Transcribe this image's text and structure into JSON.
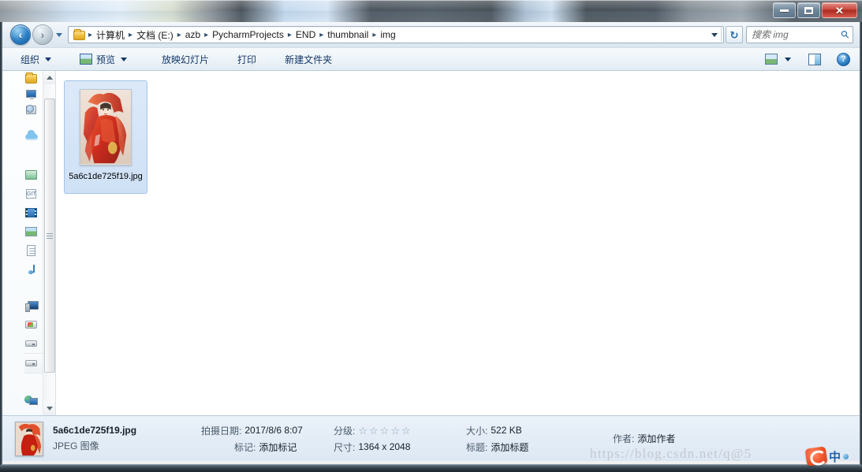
{
  "window": {
    "controls": {
      "minimize_label": "–",
      "maximize_label": "",
      "close_label": "✕"
    }
  },
  "address_bar": {
    "back_glyph": "‹",
    "forward_glyph": "›",
    "history_icon": "chevron-down-icon",
    "folder_icon": "folder-icon",
    "separator": "▸",
    "breadcrumbs": [
      {
        "label": "计算机"
      },
      {
        "label": "文档 (E:)"
      },
      {
        "label": "azb"
      },
      {
        "label": "PycharmProjects"
      },
      {
        "label": "END"
      },
      {
        "label": "thumbnail"
      },
      {
        "label": "img"
      }
    ],
    "refresh_icon": "refresh-icon",
    "search": {
      "placeholder": "搜索 img",
      "value": "",
      "icon": "search-icon"
    }
  },
  "toolbar": {
    "organize_label": "组织",
    "preview_label": "预览",
    "slideshow_label": "放映幻灯片",
    "print_label": "打印",
    "new_folder_label": "新建文件夹",
    "view_icon": "view-mode-icon",
    "panes_icon": "preview-pane-icon",
    "help_icon": "help-icon",
    "help_glyph": "?"
  },
  "nav_pane": {
    "items": [
      {
        "icon": "folder-icon",
        "name": "favorites"
      },
      {
        "icon": "desktop-icon",
        "name": "desktop"
      },
      {
        "icon": "recent-places-icon",
        "name": "recent-places"
      },
      {
        "icon": "cloud-icon",
        "name": "onedrive"
      },
      {
        "icon": "libraries-icon",
        "name": "libraries"
      },
      {
        "icon": "git-folder-icon",
        "name": "git"
      },
      {
        "icon": "video-icon",
        "name": "videos"
      },
      {
        "icon": "pictures-icon",
        "name": "pictures"
      },
      {
        "icon": "documents-icon",
        "name": "documents"
      },
      {
        "icon": "music-icon",
        "name": "music"
      },
      {
        "icon": "computer-icon",
        "name": "computer"
      },
      {
        "icon": "system-drive-icon",
        "name": "system-drive"
      },
      {
        "icon": "drive-icon",
        "name": "drive-d"
      },
      {
        "icon": "drive-icon",
        "name": "drive-e"
      },
      {
        "icon": "network-icon",
        "name": "network"
      }
    ],
    "scrollbar": {
      "up_arrow": "scroll-up-arrow",
      "down_arrow": "scroll-down-arrow"
    }
  },
  "file_list": {
    "items": [
      {
        "name": "5a6c1de725f19.jpg",
        "selected": true,
        "thumbnail_alt": "woman-in-red-hanfu-photo"
      }
    ]
  },
  "details_pane": {
    "file_name": "5a6c1de725f19.jpg",
    "file_type": "JPEG 图像",
    "date_taken_label": "拍摄日期:",
    "date_taken_value": "2017/8/6 8:07",
    "tags_label": "标记:",
    "tags_value": "添加标记",
    "rating_label": "分级:",
    "rating_stars": 0,
    "rating_star_total": 5,
    "star_glyph": "☆",
    "dimensions_label": "尺寸:",
    "dimensions_value": "1364 x 2048",
    "size_label": "大小:",
    "size_value": "522 KB",
    "title_label": "标题:",
    "title_value": "添加标题",
    "author_label": "作者:",
    "author_value": "添加作者"
  },
  "overlay": {
    "watermark_text": "https://blog.csdn.net/q@5",
    "ime_language": "中",
    "ime_logo": "sogou-ime-logo"
  },
  "colors": {
    "accent_blue": "#1559a0",
    "selection_fill": "#dce9f9",
    "selection_border": "#a3c4e8",
    "close_button_red": "#c9483c",
    "crumb_text": "#1a1a1a",
    "toolbar_text": "#15386b"
  }
}
